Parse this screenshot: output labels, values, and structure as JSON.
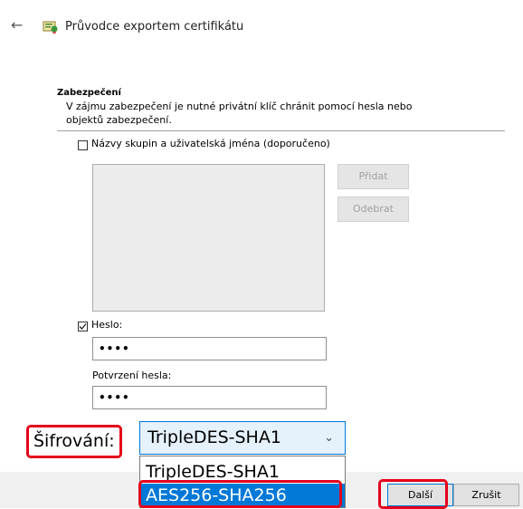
{
  "window": {
    "back_icon": "back-arrow-icon",
    "wizard_icon": "certificate-wizard-icon",
    "title": "Průvodce exportem certifikátu"
  },
  "security": {
    "heading": "Zabezpečení",
    "description": "V zájmu zabezpečení je nutné privátní klíč chránit pomocí hesla nebo objektů zabezpečení.",
    "groups_checkbox_label": "Názvy skupin a uživatelská jména (doporučeno)",
    "groups_checked": false,
    "add_button": "Přidat",
    "remove_button": "Odebrat",
    "password_checkbox_label": "Heslo:",
    "password_checked": true,
    "password_value": "••••",
    "confirm_label": "Potvrzení hesla:",
    "confirm_value": "••••"
  },
  "encryption": {
    "label": "Šifrování:",
    "selected": "TripleDES-SHA1",
    "options": [
      "TripleDES-SHA1",
      "AES256-SHA256"
    ],
    "highlighted_option": "AES256-SHA256"
  },
  "footer": {
    "next_button": "Další",
    "cancel_button": "Zrušit"
  },
  "colors": {
    "highlight_red": "#e4001b",
    "selection_blue": "#0078d7"
  }
}
